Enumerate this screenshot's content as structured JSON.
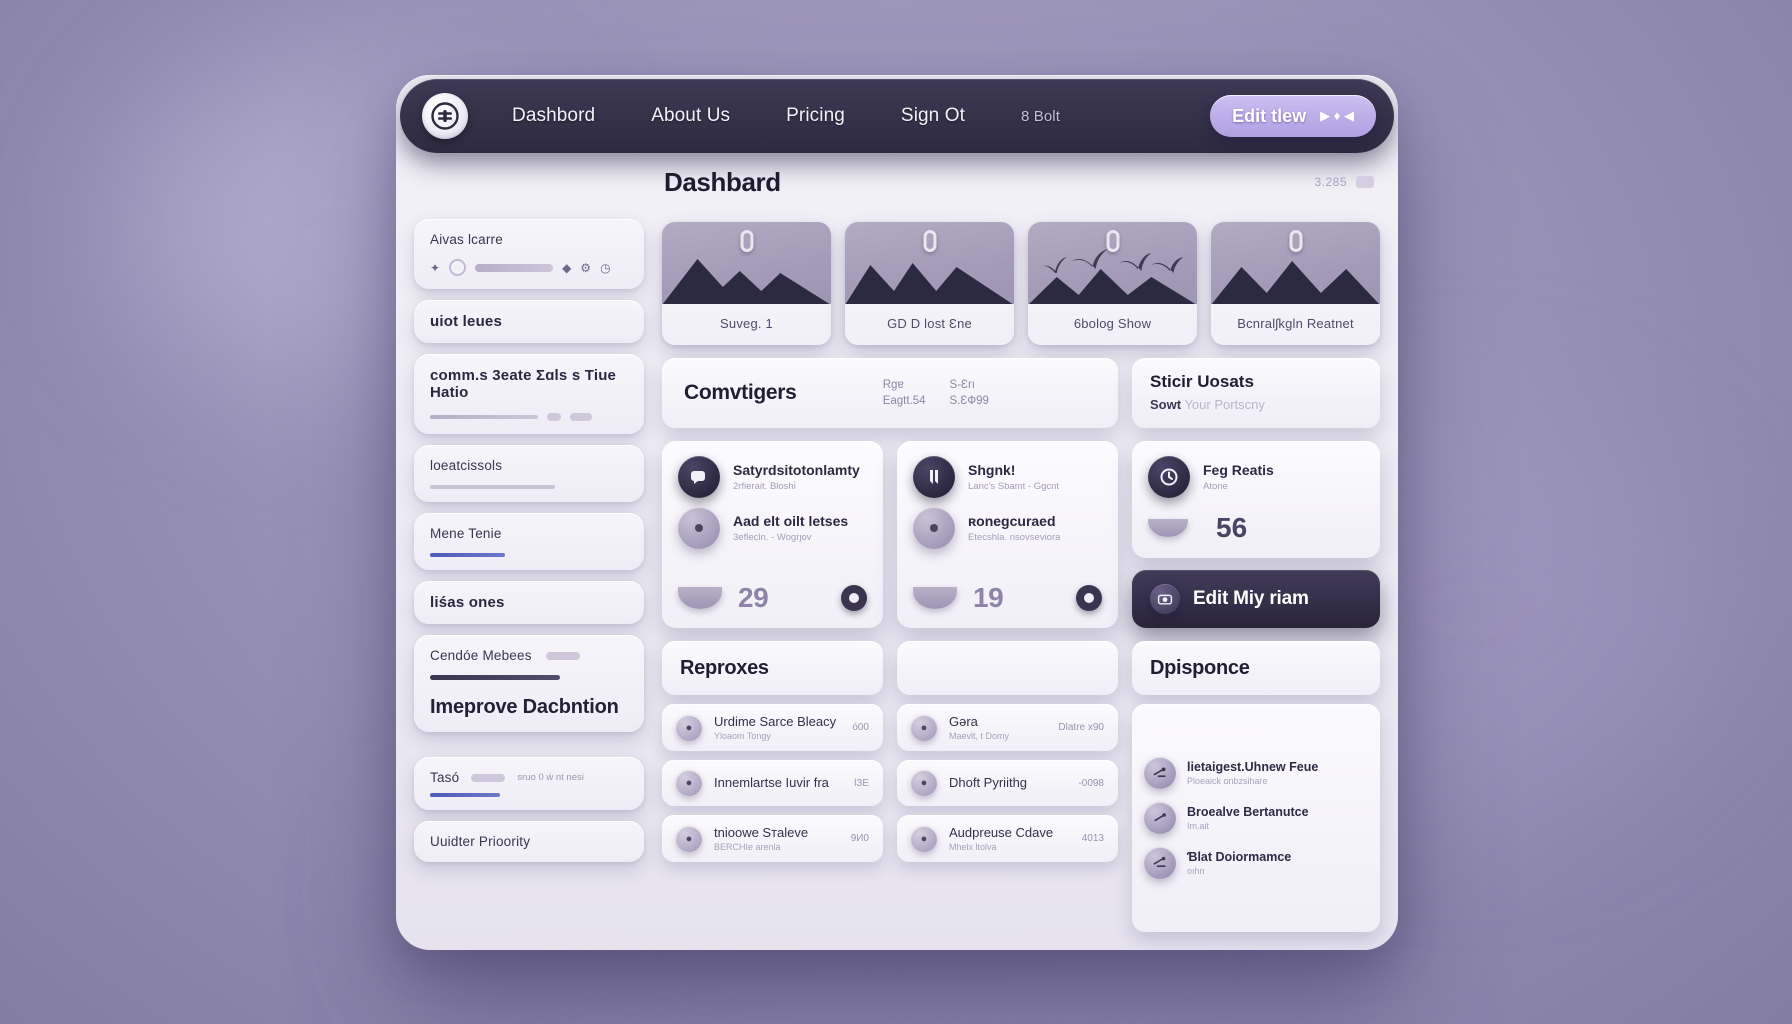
{
  "theme": {
    "accent": "#bdaee9",
    "nav_bg": "#353149",
    "surface": "#f6f5fa",
    "text_dark": "#211d32",
    "text_muted": "#a49db8",
    "backdrop": "#9a93b8"
  },
  "navbar": {
    "logo_icon": "brand-circle-icon",
    "links": [
      {
        "label": "Dashbord"
      },
      {
        "label": "About Us"
      },
      {
        "label": "Pricing"
      },
      {
        "label": "Sign Ot"
      }
    ],
    "muted_link": {
      "label": "8 Bolt"
    },
    "cta": {
      "label": "Edit tlew",
      "glyphs": "▶ ♦ ◀"
    }
  },
  "sidebar": {
    "cards": [
      {
        "title": "Aivas lcarre",
        "icons": [
          "sparkle-icon",
          "ring-icon",
          "progress-bar",
          "tag-icon",
          "gear-icon",
          "clock-icon"
        ]
      },
      {
        "title": "uiot leues"
      },
      {
        "title": "comm.s 3eate  Σɑls s Tiue Hatio"
      },
      {
        "title": "loeatcissols"
      },
      {
        "title": "Mene Tenie"
      },
      {
        "title": "liśas ones"
      },
      {
        "title": "Cendóe Mebees",
        "headline": "Imeprove Dacbntion"
      },
      {
        "title": "Tasó",
        "meta": "sruo 0 ẃ nt nesi"
      },
      {
        "title": "Uuidter Prioority"
      }
    ]
  },
  "main": {
    "page_title": "Dashbard",
    "head_count": "3.285",
    "thumbs": [
      {
        "label": "Suveg. 1",
        "art": "mountains"
      },
      {
        "label": "GD D lost Ɛne",
        "art": "mountains"
      },
      {
        "label": "6bolog Show",
        "art": "palms"
      },
      {
        "label": "Bcnralʃkgln Reatnet",
        "art": "mountains"
      }
    ],
    "strip": {
      "title": "Comvtigers",
      "kv": [
        {
          "k": "Rgɐ",
          "v": "S-Ɛrı"
        },
        {
          "k": "Eagtt.54",
          "v": "S.ƐФ99"
        }
      ],
      "side": {
        "title": "Sticir Uosats",
        "sub_strong": "Sowt",
        "sub_muted": "Your Portscny"
      }
    },
    "metrics": [
      {
        "icon": "chat-bubble-icon",
        "h1": "Satyrdsitotonlamty",
        "s1": "2rfierait.  Bloshiͥ",
        "h2": "Aad elt oilt letses",
        "s2": "3eflecln. -  Wogrȷov",
        "number": "29",
        "badge_icon": "donut-icon"
      },
      {
        "icon": "bookmark-icon",
        "h1": "Shgnk!",
        "s1": "Lanc's  Sbamt -  Ggcnt",
        "h2": "ʀonegcuraed",
        "s2": "Etecshla.  nsovseviora",
        "number": "19",
        "badge_icon": "donut-icon"
      }
    ],
    "right_stack": {
      "card": {
        "icon": "clock-icon",
        "h1": "Feg Reatis",
        "s1": "Atone",
        "number": "56"
      },
      "button": {
        "icon": "camera-icon",
        "label": "Edit Miy riam"
      }
    },
    "lists": [
      {
        "title": "Reproxes",
        "items": [
          {
            "h": "Urdime Sarce Bleacy",
            "s": "Yloaom Tongy",
            "v": "ó00"
          },
          {
            "h": "Innemlаrtse Iuvir fra",
            "s": "",
            "v": "lЗЕ"
          },
          {
            "h": "tnioowe Sтaleve",
            "s": "BERCHIe arenla",
            "v": "9И0"
          }
        ]
      },
      {
        "title": "",
        "items": [
          {
            "h": "Gəra",
            "s": "Maevlt, t Domy",
            "v": "Dlatre х90"
          },
          {
            "h": "Dhoft Pyriithg",
            "s": "",
            "v": "-0098"
          },
          {
            "h": "Audpreuse Cdave",
            "s": "Mhelx ltolva",
            "v": "4013"
          }
        ]
      }
    ],
    "stack_panel": {
      "title": "Dpisponce",
      "items": [
        {
          "h": "lietaigest.Uhnew Feue",
          "s": "Ploeaick onbzsihare",
          "icon": "tools-icon"
        },
        {
          "h": "Broealve Bertanutce",
          "s": "Im.ait",
          "icon": "tools-icon"
        },
        {
          "h": "Ɓlat Doiormamce",
          "s": "oıhn",
          "icon": "tools-icon"
        }
      ]
    }
  }
}
